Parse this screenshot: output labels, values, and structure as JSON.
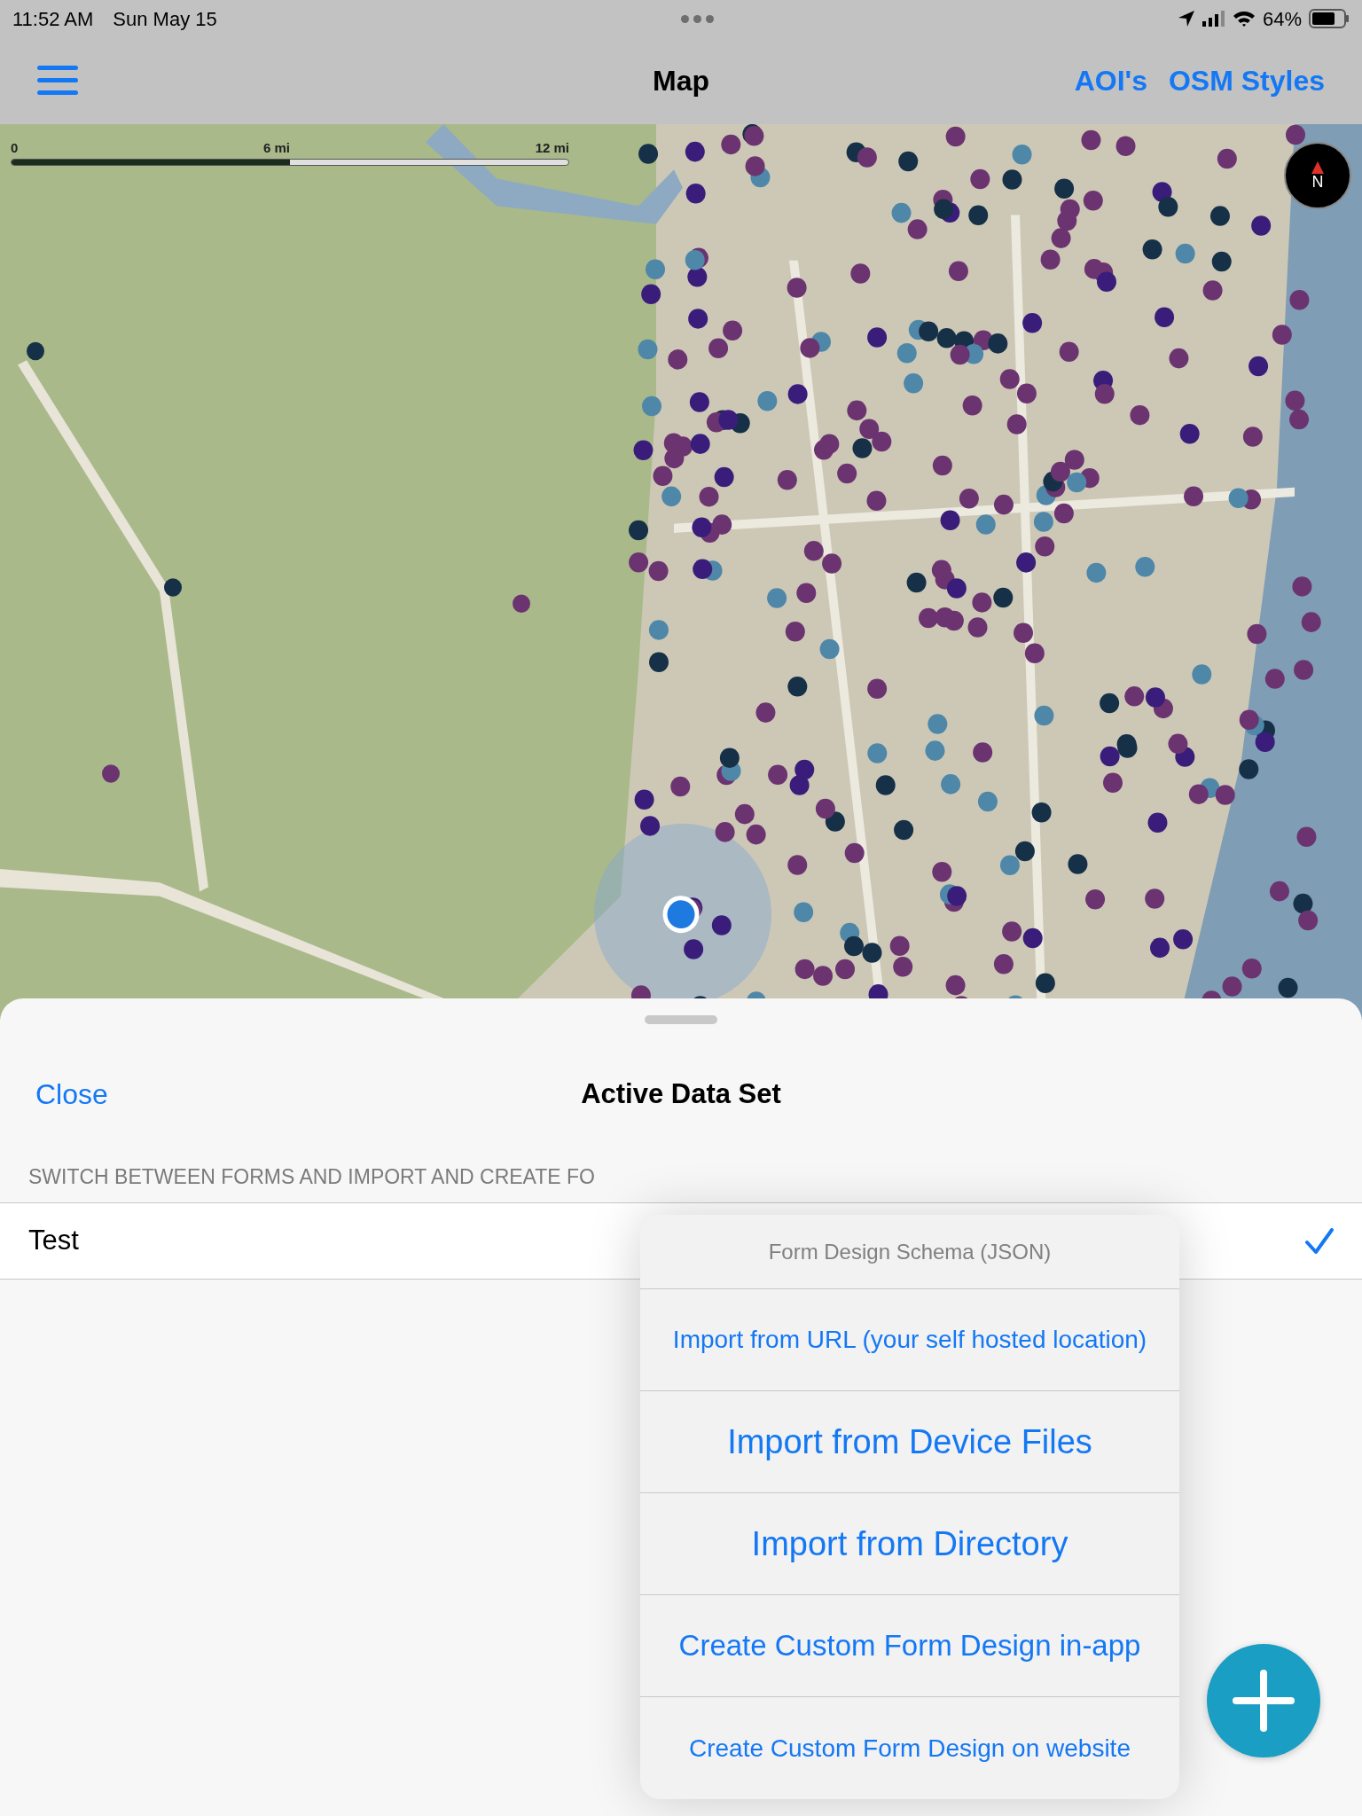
{
  "status_bar": {
    "time": "11:52 AM",
    "date": "Sun May 15",
    "battery": "64%"
  },
  "nav_bar": {
    "title": "Map",
    "actions": [
      "AOI's",
      "OSM Styles"
    ]
  },
  "map": {
    "scale_labels": [
      "0",
      "6 mi",
      "12 mi"
    ],
    "compass": "N"
  },
  "sheet": {
    "close": "Close",
    "title": "Active Data Set",
    "section_header": "SWITCH BETWEEN FORMS AND IMPORT AND CREATE FO",
    "rows": [
      {
        "label": "Test",
        "selected": true
      }
    ]
  },
  "popover": {
    "title": "Form Design Schema (JSON)",
    "items": [
      {
        "label": "Import from URL (your self hosted location)",
        "kind": "small"
      },
      {
        "label": "Import from Device Files",
        "kind": "large"
      },
      {
        "label": "Import from Directory",
        "kind": "large"
      },
      {
        "label": "Create Custom Form Design in-app",
        "kind": "medium"
      },
      {
        "label": "Create Custom Form Design on website",
        "kind": "small"
      }
    ]
  }
}
